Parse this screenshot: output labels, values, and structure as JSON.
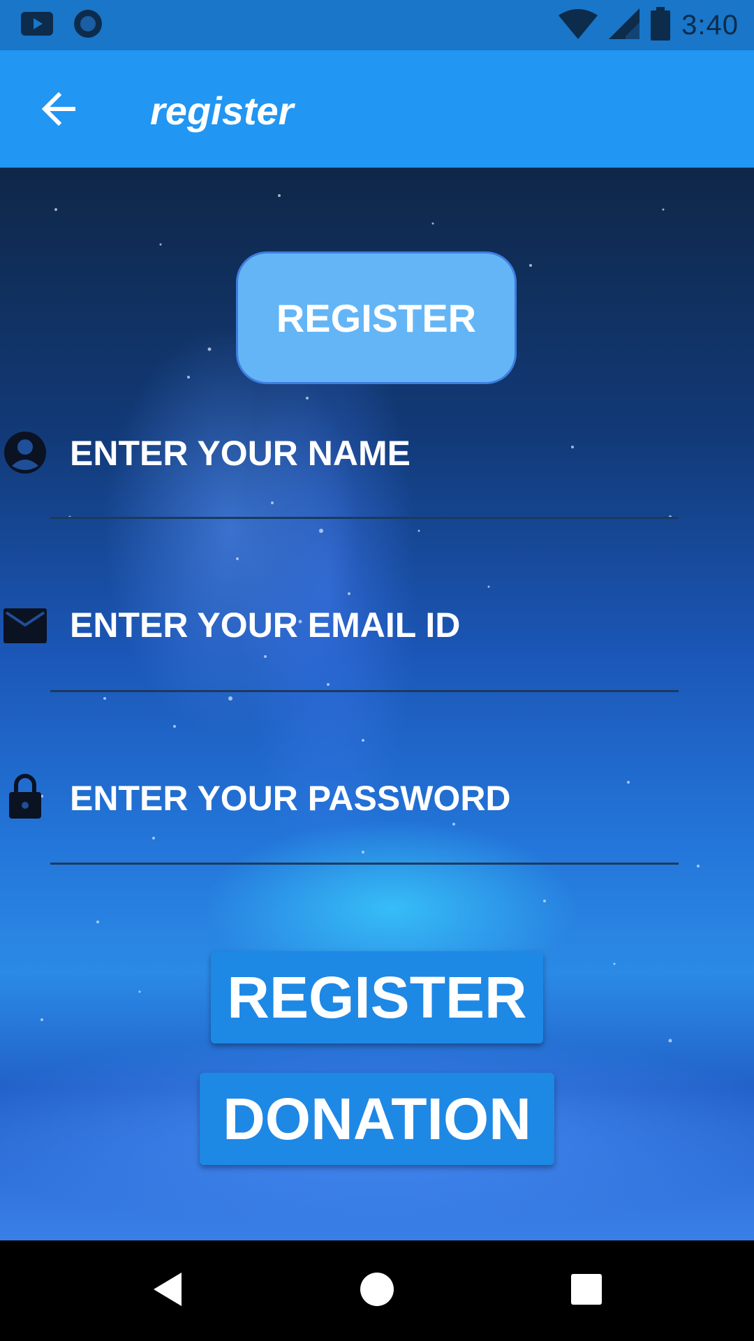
{
  "status_bar": {
    "time": "3:40",
    "icons": [
      "youtube-icon",
      "circle-app-icon",
      "wifi-icon",
      "signal-icon",
      "battery-icon"
    ]
  },
  "app_bar": {
    "title": "register",
    "back_icon": "arrow-back-icon",
    "color": "#2196f3"
  },
  "main": {
    "top_button_label": "REGISTER",
    "fields": [
      {
        "icon": "account-circle-icon",
        "placeholder": "ENTER YOUR NAME"
      },
      {
        "icon": "mail-icon",
        "placeholder": "ENTER YOUR EMAIL ID"
      },
      {
        "icon": "lock-icon",
        "placeholder": "ENTER YOUR PASSWORD"
      }
    ],
    "register_button_label": "REGISTER",
    "donation_button_label": "DONATION"
  },
  "nav_bar": {
    "icons": [
      "back-triangle-icon",
      "home-circle-icon",
      "recents-square-icon"
    ]
  },
  "colors": {
    "status_bar": "#1976c8",
    "button_light": "#64b5f6",
    "button_primary": "#1e88e5"
  }
}
